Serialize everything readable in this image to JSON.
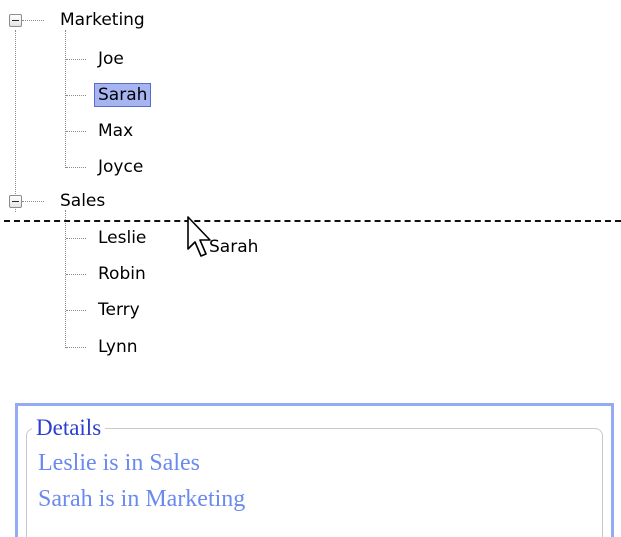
{
  "tree": {
    "groups": [
      {
        "label": "Marketing",
        "members": [
          "Joe",
          "Sarah",
          "Max",
          "Joyce"
        ]
      },
      {
        "label": "Sales",
        "members": [
          "Leslie",
          "Robin",
          "Terry",
          "Lynn"
        ]
      }
    ],
    "selected_member": "Sarah"
  },
  "drag": {
    "text": "Sarah",
    "icon": "arrow-cursor-icon"
  },
  "details": {
    "title": "Details",
    "lines": [
      "Leslie is in Sales",
      "Sarah is in Marketing"
    ]
  },
  "colors": {
    "selection_fill": "#a6b5f2",
    "panel_border": "#93abf4",
    "legend_text": "#2c3ed1",
    "details_text": "#6b8af0"
  }
}
